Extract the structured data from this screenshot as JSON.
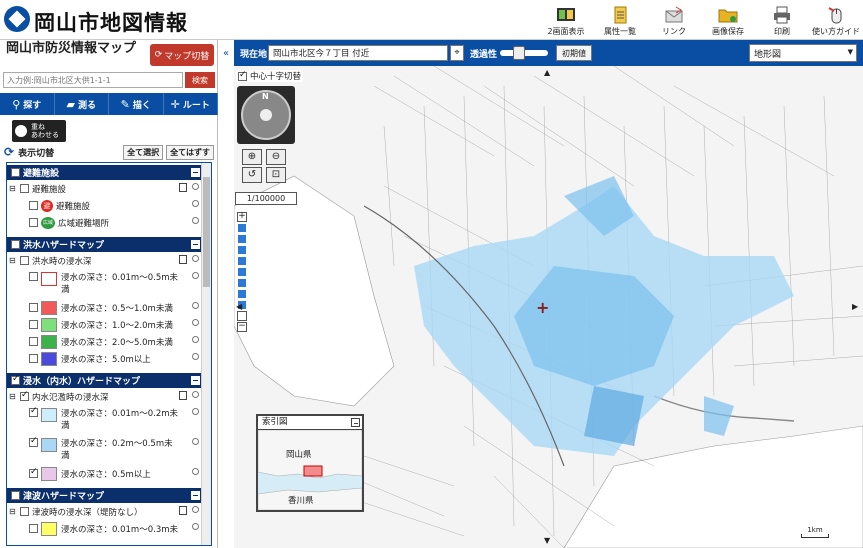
{
  "header": {
    "app_title": "岡山市地図情報",
    "toolbar": [
      {
        "label": "2画面表示",
        "icon": "dual-screen-icon"
      },
      {
        "label": "属性一覧",
        "icon": "attribute-list-icon"
      },
      {
        "label": "リンク",
        "icon": "link-icon"
      },
      {
        "label": "画像保存",
        "icon": "folder-save-icon"
      },
      {
        "label": "印刷",
        "icon": "printer-icon"
      },
      {
        "label": "使い方ガイド",
        "icon": "mouse-guide-icon"
      }
    ]
  },
  "panel": {
    "title": "岡山市防災情報マップ",
    "map_switch": "マップ切替",
    "address_placeholder": "入力例:岡山市北区大供1-1-1",
    "search_label": "検索",
    "nav": [
      {
        "label": "探す",
        "icon": "search-icon"
      },
      {
        "label": "測る",
        "icon": "ruler-icon"
      },
      {
        "label": "描く",
        "icon": "draw-icon"
      },
      {
        "label": "ルート",
        "icon": "route-icon"
      }
    ],
    "overlay_label": "重ね\nあわせる",
    "toggle_label": "表示切替",
    "select_all": "全て選択",
    "deselect_all": "全てはずす",
    "groups": [
      {
        "title": "避難施設",
        "sub": "避難施設",
        "items": [
          "避難施設",
          "広域避難場所"
        ]
      },
      {
        "title": "洪水ハザードマップ",
        "sub": "洪水時の浸水深",
        "items": [
          "浸水の深さ：0.01m〜0.5m未満",
          "浸水の深さ：0.5〜1.0m未満",
          "浸水の深さ：1.0〜2.0m未満",
          "浸水の深さ：2.0〜5.0m未満",
          "浸水の深さ：5.0m以上"
        ]
      },
      {
        "title": "浸水（内水）ハザードマップ",
        "sub": "内水氾濫時の浸水深",
        "items": [
          "浸水の深さ：0.01m〜0.2m未満",
          "浸水の深さ：0.2m〜0.5m未満",
          "浸水の深さ：0.5m以上"
        ]
      },
      {
        "title": "津波ハザードマップ",
        "sub": "津波時の浸水深（堤防なし）",
        "items": [
          "浸水の深さ：0.01m〜0.3m未"
        ]
      }
    ],
    "badges": {
      "evac": "避",
      "wide": "広域"
    }
  },
  "colors": {
    "brand_blue": "#0a4ea3",
    "accent_red": "#c0392b",
    "flood_1": "#ffffff",
    "flood_2": "#f25a5a",
    "flood_3": "#7de07d",
    "flood_4": "#3bb34a",
    "flood_5": "#4a4adc",
    "inland_1": "#cfeefc",
    "inland_2": "#a9d8f5",
    "inland_3": "#e8c8e8",
    "tsunami_1": "#ffff66"
  },
  "mapbar": {
    "location_label": "現在地",
    "location_value": "岡山市北区今７丁目 付近",
    "opacity_label": "透過性",
    "init_label": "初期値",
    "basemap": "地形図",
    "opacity": 0.35
  },
  "map": {
    "crosshair_label": "中心十字切替",
    "scale_label": "1/100000",
    "compass_label": "N",
    "minimap_title": "索引図",
    "minimap_okayama": "岡山県",
    "minimap_kagawa": "香川県",
    "scale_bar": "1km"
  }
}
